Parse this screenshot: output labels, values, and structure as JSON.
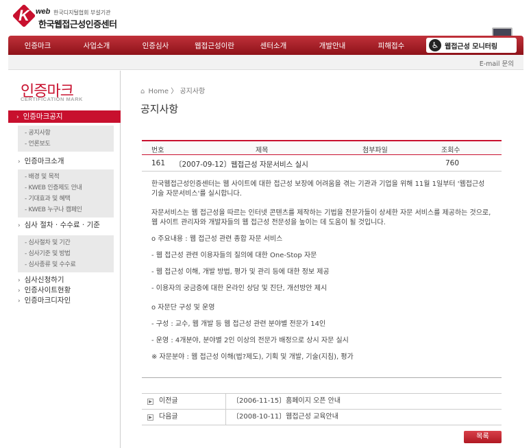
{
  "brand": {
    "logo_k": "K",
    "logo_web": "web",
    "org_sub": "한국디지털협회 부설기관",
    "org_title": "한국웹접근성인증센터"
  },
  "gnb": {
    "items": [
      "인증마크",
      "사업소개",
      "인증심사",
      "웹접근성이란",
      "센터소개",
      "개발안내",
      "피해접수"
    ],
    "monitor_label": "웹접근성 모니터링"
  },
  "subbar": {
    "email": "E-mail 문의"
  },
  "lnb": {
    "title": "인증마크",
    "subtitle": "CERTIFICATION MARK",
    "active": "인증마크공지",
    "groups": [
      {
        "label": null,
        "sub": [
          "- 공지사항",
          "- 언론보도"
        ]
      },
      {
        "label": "인증마크소개",
        "sub": [
          "- 배경 및 목적",
          "- KWEB 인증제도 안내",
          "- 기대효과 및 혜택",
          "- KWEB 누구나 캠페인"
        ]
      },
      {
        "label": "심사 절차 · 수수료 · 기준",
        "sub": [
          "- 심사절차 및 기간",
          "- 심사기준 및 방법",
          "- 심사종류 및 수수료"
        ]
      }
    ],
    "extra": [
      "심사신청하기",
      "인증사이트현황",
      "인증마크디자인"
    ]
  },
  "breadcrumb": {
    "home": "Home",
    "sep": "〉",
    "current": "공지사항"
  },
  "page_title": "공지사항",
  "board": {
    "columns": {
      "no": "번호",
      "subject": "제목",
      "attach": "첨부파일",
      "views": "조회수"
    },
    "row": {
      "no": "161",
      "subject": "〔2007-09-12〕웹접근성 자문서비스 실시",
      "views": "760"
    },
    "body": [
      "한국웹접근성인증센터는 웹 사이트에 대한 접근성 보장에 어려움을 겪는 기관과 기업을 위해 11월 1일부터 '웹접근성 기술 자문서비스'를 실시합니다.",
      "자문서비스는 웹 접근성을 따르는 인터넷 콘텐츠를 제작하는 기법을 전문가들이 상세한 자문 서비스를 제공하는 것으로, 웹 사이트 관리자와 개발자들의 웹 접근성 전문성을 높이는 데 도움이 될 것입니다.",
      "o 주요내용 : 웹 접근성 관련 종합 자문 서비스",
      "- 웹 접근성 관련 이용자들의 질의에 대한 One-Stop 자문",
      "- 웹 접근성 이해, 개발 방법, 평가 및 관리 등에 대한 정보 제공",
      "- 이용자의 궁금증에 대한 온라인 상담 및 진단, 개선방안 제시",
      "o 자문단 구성 및 운영",
      "- 구성 : 교수, 웹 개발 등 웹 접근성 관련 분야별 전문가 14인",
      "- 운영 : 4개분야, 분야별 2인 이상의 전문가 배정으로 상시 자문 실시",
      "※ 자문분야 : 웹 접근성 이해(법?제도), 기획 및 개발, 기술(지침), 평가"
    ]
  },
  "nav": {
    "prev_label": "이전글",
    "prev_title": "〔2006-11-15〕홈페이지 오픈 안내",
    "next_label": "다음글",
    "next_title": "〔2008-10-11〕웹접근성 교육안내"
  },
  "list_button": "목록"
}
